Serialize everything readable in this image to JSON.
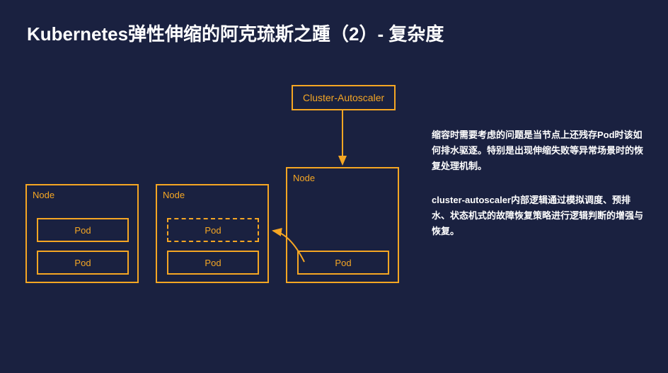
{
  "title": "Kubernetes弹性伸缩的阿克琉斯之踵（2）- 复杂度",
  "autoscaler": {
    "label": "Cluster-Autoscaler"
  },
  "nodes": [
    {
      "label": "Node",
      "pods": [
        {
          "label": "Pod",
          "dashed": false
        },
        {
          "label": "Pod",
          "dashed": false
        }
      ]
    },
    {
      "label": "Node",
      "pods": [
        {
          "label": "Pod",
          "dashed": true
        },
        {
          "label": "Pod",
          "dashed": false
        }
      ]
    },
    {
      "label": "Node",
      "pods": [
        {
          "label": "Pod",
          "dashed": false
        }
      ]
    }
  ],
  "paragraphs": {
    "p1": "缩容时需要考虑的问题是当节点上还残存Pod时该如何排水驱逐。特别是出现伸缩失败等异常场景时的恢复处理机制。",
    "p2": "cluster-autoscaler内部逻辑通过模拟调度、预排水、状态机式的故障恢复策略进行逻辑判断的增强与恢复。"
  }
}
